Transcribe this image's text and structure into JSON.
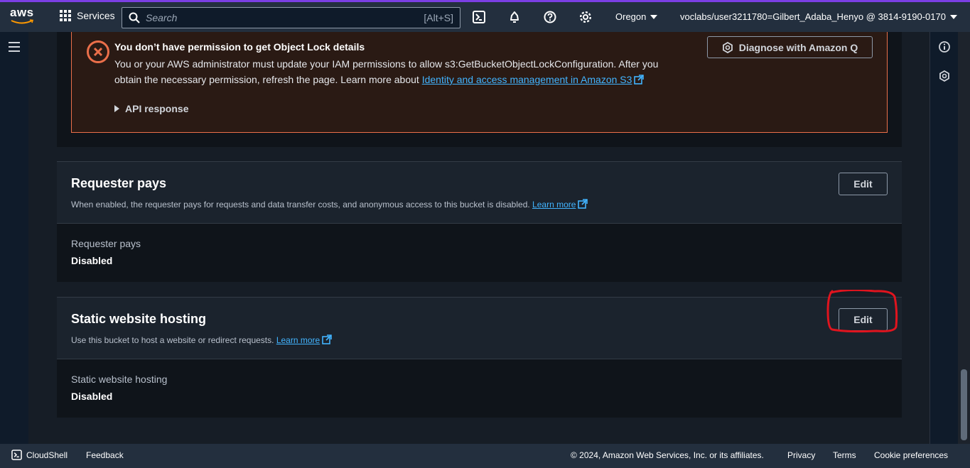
{
  "topnav": {
    "logo": "aws",
    "services_label": "Services",
    "search_placeholder": "Search",
    "search_shortcut": "[Alt+S]",
    "region": "Oregon",
    "account": "voclabs/user3211780=Gilbert_Adaba_Henyo @ 3814-9190-0170"
  },
  "alert": {
    "title": "You don’t have permission to get Object Lock details",
    "body_text": "You or your AWS administrator must update your IAM permissions to allow s3:GetBucketObjectLockConfiguration. After you obtain the necessary permission, refresh the page. Learn more about ",
    "link_text": "Identity and access management in Amazon S3",
    "api_response_label": "API response",
    "diagnose_label": "Diagnose with Amazon Q",
    "color": "#eb6f4a"
  },
  "requester_pays": {
    "title": "Requester pays",
    "description": "When enabled, the requester pays for requests and data transfer costs, and anonymous access to this bucket is disabled.",
    "learn_more": "Learn more",
    "edit_label": "Edit",
    "field_label": "Requester pays",
    "field_value": "Disabled"
  },
  "static_hosting": {
    "title": "Static website hosting",
    "description": "Use this bucket to host a website or redirect requests.",
    "learn_more": "Learn more",
    "edit_label": "Edit",
    "field_label": "Static website hosting",
    "field_value": "Disabled"
  },
  "footer": {
    "cloudshell": "CloudShell",
    "feedback": "Feedback",
    "copyright": "© 2024, Amazon Web Services, Inc. or its affiliates.",
    "privacy": "Privacy",
    "terms": "Terms",
    "cookie": "Cookie preferences"
  },
  "colors": {
    "link": "#42b4ff",
    "annotation": "#e0141e"
  }
}
